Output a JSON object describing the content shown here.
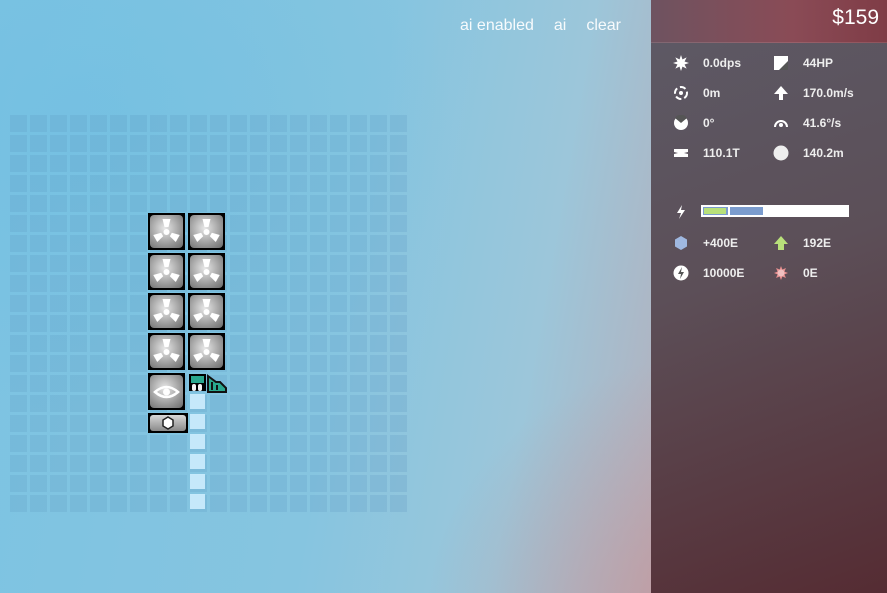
{
  "topmenu": {
    "ai_enabled": "ai enabled",
    "ai": "ai",
    "clear": "clear"
  },
  "panel": {
    "money": "$159",
    "stats": {
      "dps": "0.0dps",
      "hp": "44HP",
      "range": "0m",
      "speed": "170.0m/s",
      "arc": "0°",
      "turn_rate": "41.6°/s",
      "mass": "110.1T",
      "radius": "140.2m"
    },
    "energy": {
      "level_fraction": 0.41,
      "regen": "+400E",
      "thrust_cost": "192E",
      "storage": "10000E",
      "weapon_cost": "0E"
    }
  },
  "icons": {
    "dps": "burst-icon",
    "hp": "armor-icon",
    "range": "range-icon",
    "speed": "arrow-up-icon",
    "arc": "arc-icon",
    "turn": "turn-icon",
    "mass": "mass-icon",
    "radius": "circle-icon",
    "energy": "bolt-icon",
    "regen": "hexagon-icon",
    "thrust": "thrust-arrow-icon",
    "storage": "battery-icon",
    "weapon": "gear-icon"
  },
  "ship": {
    "parts": [
      {
        "type": "armor-fan"
      },
      {
        "type": "armor-fan"
      },
      {
        "type": "armor-fan"
      },
      {
        "type": "armor-fan"
      },
      {
        "type": "armor-fan"
      },
      {
        "type": "armor-fan"
      },
      {
        "type": "armor-fan"
      },
      {
        "type": "armor-fan"
      },
      {
        "type": "cockpit-eye"
      }
    ]
  }
}
